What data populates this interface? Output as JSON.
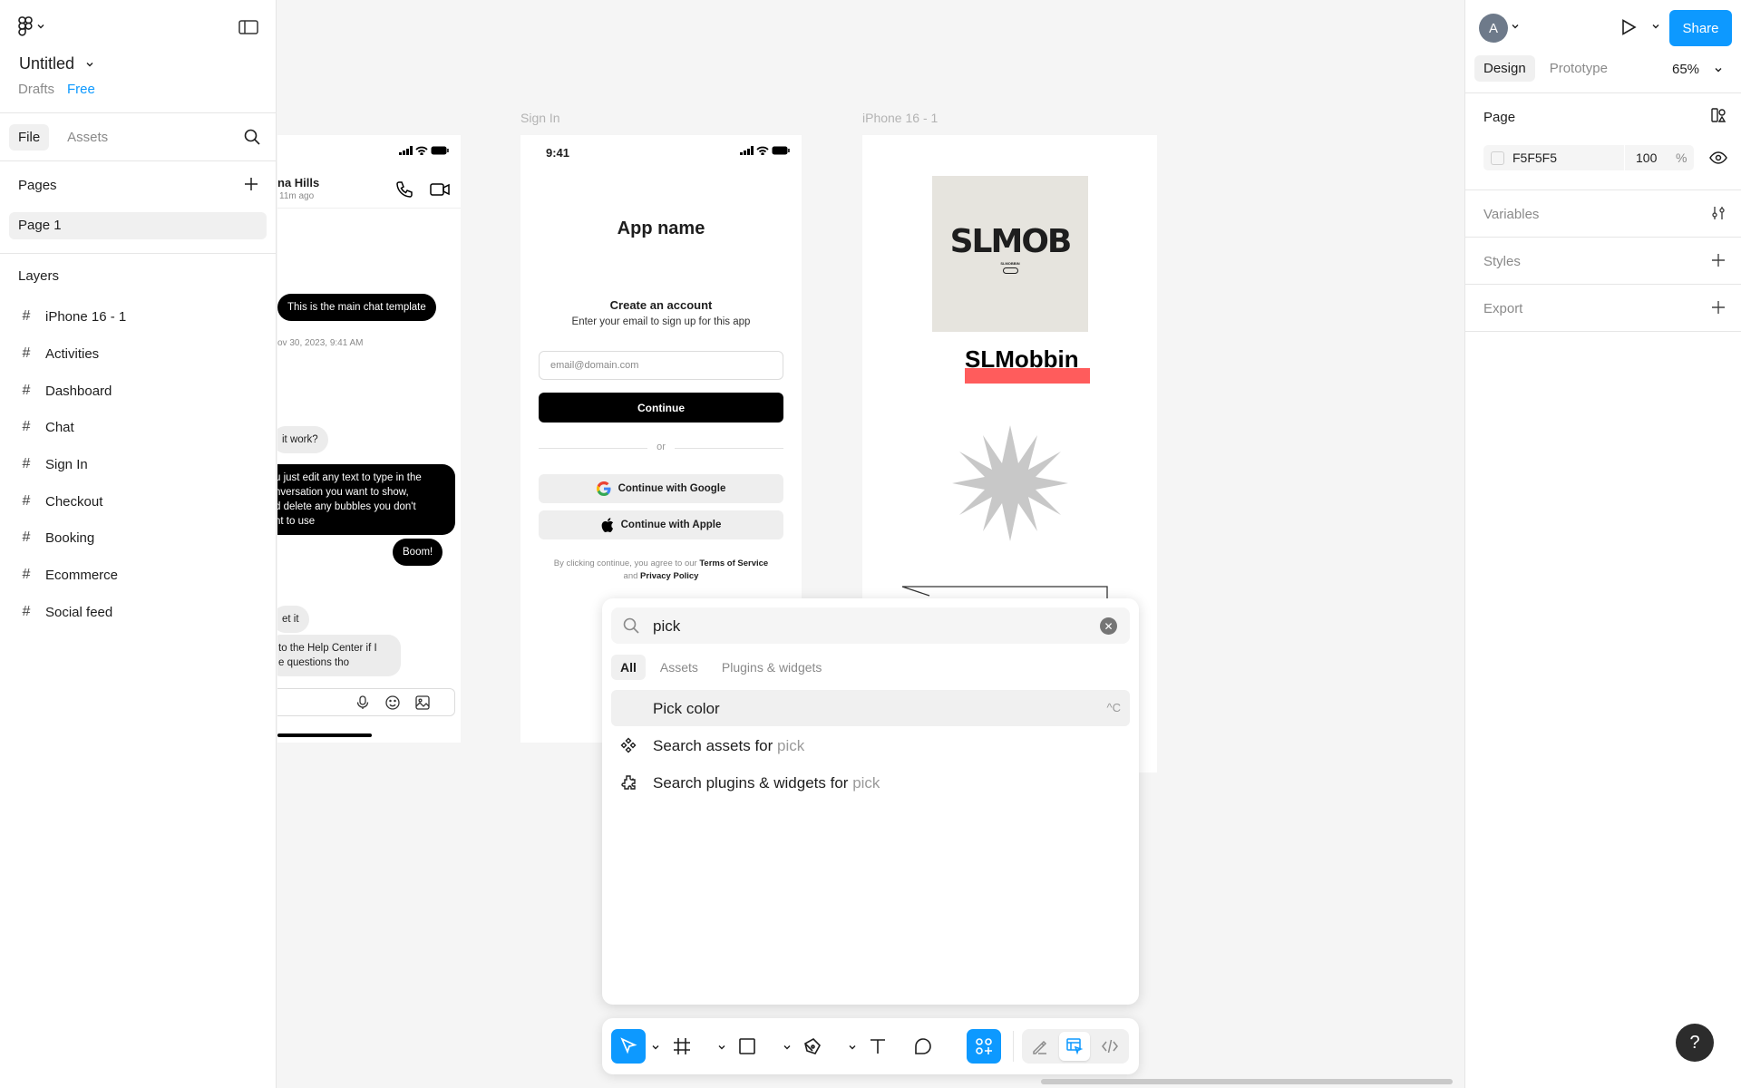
{
  "file": {
    "name": "Untitled",
    "location": "Drafts",
    "plan": "Free"
  },
  "left_panel": {
    "tabs": [
      "File",
      "Assets"
    ],
    "pages_title": "Pages",
    "pages": [
      "Page 1"
    ],
    "layers_title": "Layers",
    "layers": [
      "iPhone 16 - 1",
      "Activities",
      "Dashboard",
      "Chat",
      "Sign In",
      "Checkout",
      "Booking",
      "Ecommerce",
      "Social feed"
    ]
  },
  "right_panel": {
    "avatar_initial": "A",
    "share_label": "Share",
    "tabs": [
      "Design",
      "Prototype"
    ],
    "zoom": "65%",
    "page_title": "Page",
    "page_color": "F5F5F5",
    "page_opacity": "100",
    "opacity_unit": "%",
    "variables_title": "Variables",
    "styles_title": "Styles",
    "export_title": "Export"
  },
  "canvas": {
    "chat": {
      "contact": "na Hills",
      "last_seen": "11m ago",
      "bubbles": [
        "This is the main chat template",
        "ov 30, 2023, 9:41 AM",
        " it work?",
        "u just edit any text to type in the\nnversation you want to show,\nd delete any bubbles you don't\nnt to use",
        "Boom!",
        "et it",
        "to the Help Center if I\ne questions tho"
      ]
    },
    "signin": {
      "label": "Sign In",
      "time": "9:41",
      "app_name": "App name",
      "create_title": "Create an account",
      "create_sub": "Enter your email to sign up for this app",
      "email_placeholder": "email@domain.com",
      "continue_label": "Continue",
      "or": "or",
      "google_label": "Continue with Google",
      "apple_label": "Continue with Apple",
      "terms_prefix": "By clicking continue, you agree to our",
      "terms_link": "Terms of Service",
      "terms_and": "and",
      "privacy_link": "Privacy Policy"
    },
    "iphone": {
      "label": "iPhone 16 - 1",
      "logo_text": "SLMOB",
      "logo_small": "SLMOBBIN",
      "brand": "SLMobbin"
    }
  },
  "search_popup": {
    "query": "pick",
    "tabs": [
      "All",
      "Assets",
      "Plugins & widgets"
    ],
    "results": [
      {
        "label": "Pick color",
        "shortcut": "^C"
      },
      {
        "label": "Search assets for",
        "query": "pick"
      },
      {
        "label": "Search plugins & widgets for",
        "query": "pick"
      }
    ]
  },
  "help_label": "?",
  "colors": {
    "accent": "#0d99ff",
    "brand_bar": "#ff5c5c"
  }
}
